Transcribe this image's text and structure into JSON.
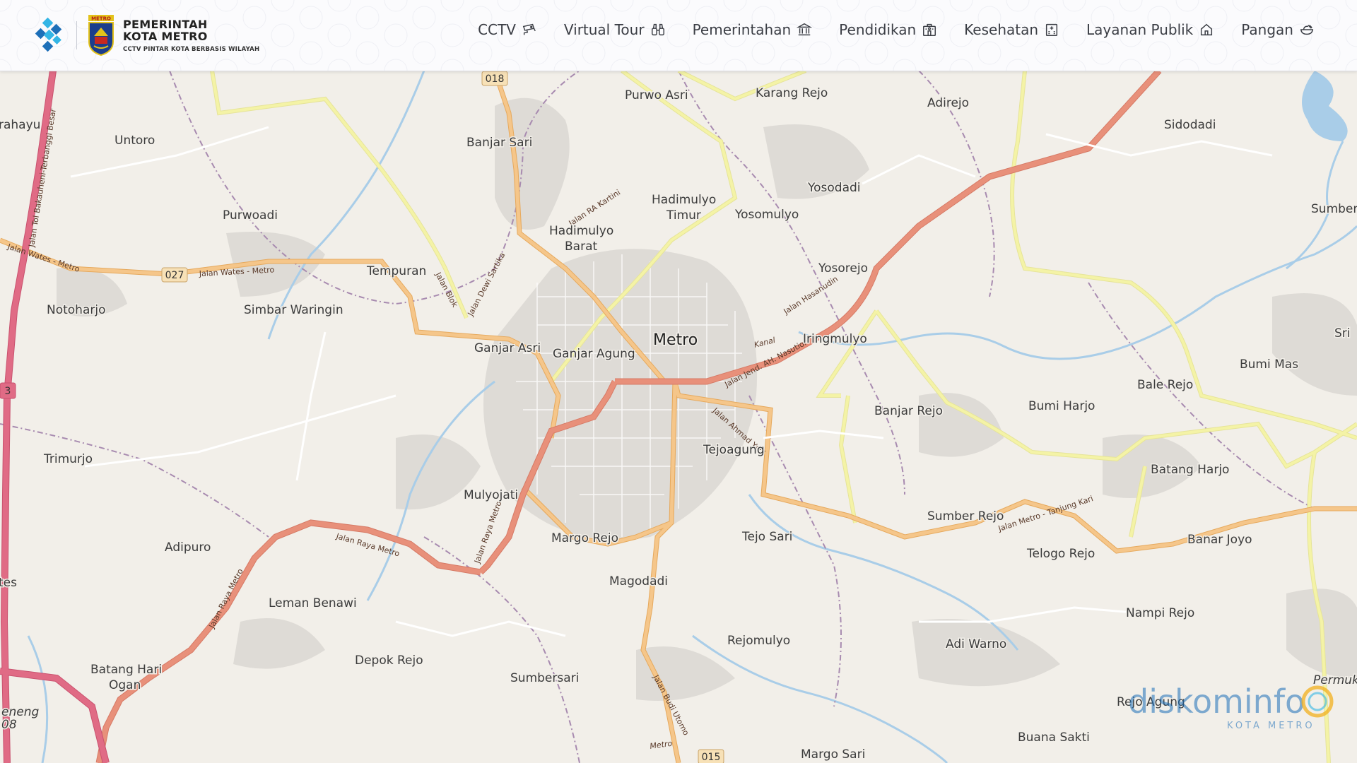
{
  "header": {
    "brand_line1": "PEMERINTAH",
    "brand_line2": "KOTA METRO",
    "brand_tagline": "CCTV PINTAR KOTA BERBASIS WILAYAH",
    "seal_text": "METRO"
  },
  "nav": [
    {
      "label": "CCTV",
      "icon": "cctv-icon"
    },
    {
      "label": "Virtual Tour",
      "icon": "binoculars-icon"
    },
    {
      "label": "Pemerintahan",
      "icon": "government-building-icon"
    },
    {
      "label": "Pendidikan",
      "icon": "school-icon"
    },
    {
      "label": "Kesehatan",
      "icon": "hospital-icon"
    },
    {
      "label": "Layanan Publik",
      "icon": "home-icon"
    },
    {
      "label": "Pangan",
      "icon": "food-bowl-icon"
    }
  ],
  "map": {
    "places": {
      "rahayu": "rahayu",
      "untoro": "Untoro",
      "banjar_sari": "Banjar Sari",
      "purwo_asri": "Purwo Asri",
      "karang_rejo": "Karang Rejo",
      "adirejo": "Adirejo",
      "sidodadi": "Sidodadi",
      "sumber_ag": "Sumber Ag",
      "purwoadi": "Purwoadi",
      "hadimulyo_timur_1": "Hadimulyo",
      "hadimulyo_timur_2": "Timur",
      "yosomulyo": "Yosomulyo",
      "yosodadi": "Yosodadi",
      "hadimulyo_barat_1": "Hadimulyo",
      "hadimulyo_barat_2": "Barat",
      "notoharjo": "Notoharjo",
      "tempuran": "Tempuran",
      "simbar_waringin": "Simbar Waringin",
      "yosorejo": "Yosorejo",
      "metro": "Metro",
      "ganjar_asri": "Ganjar Asri",
      "ganjar_agung": "Ganjar Agung",
      "iringmulyo": "Iringmulyo",
      "sri": "Sri",
      "bumi_mas": "Bumi Mas",
      "bale_rejo": "Bale Rejo",
      "banjar_rejo": "Banjar Rejo",
      "bumi_harjo": "Bumi Harjo",
      "tejoagung": "Tejoagung",
      "trimurjo": "Trimurjo",
      "batang_harjo": "Batang Harjo",
      "mulyojati": "Mulyojati",
      "sumber_rejo": "Sumber Rejo",
      "adipuro": "Adipuro",
      "margo_rejo": "Margo Rejo",
      "tejo_sari": "Tejo Sari",
      "telogo_rejo": "Telogo Rejo",
      "banar_joyo": "Banar Joyo",
      "tes": "tes",
      "magodadi": "Magodadi",
      "leman_benawi": "Leman Benawi",
      "nampi_rejo": "Nampi Rejo",
      "rejomulyo": "Rejomulyo",
      "adi_warno": "Adi Warno",
      "depok_rejo": "Depok Rejo",
      "batang_hari_1": "Batang Hari",
      "batang_hari_2": "Ogan",
      "sumbersari": "Sumbersari",
      "permuk": "Permuk",
      "rejo_agung": "Rejo Agung",
      "buana_sakti": "Buana Sakti",
      "margo_sari": "Margo Sari",
      "eneng_1": "eneng",
      "eneng_2": "08"
    },
    "roads": {
      "jalan_tol": "Jalan Tol Bakauheni-Terbanggi Besar",
      "jalan_wates_metro_1": "Jalan Wates - Metro",
      "jalan_wates_metro_2": "Jalan Wates - Metro",
      "jalan_ra_kartini": "Jalan RA Kartini",
      "jalan_blok": "Jalan Blok",
      "jalan_dewi_sartika": "Jalan Dewi Sartika",
      "jalan_hasanudin": "Jalan Hasanudin",
      "jalan_ah_nasution": "Jalan Jend. AH. Nasution",
      "jalan_ahmad_yani": "Jalan Ahmad Yani",
      "jalan_raya_metro_1": "Jalan Raya Metro",
      "jalan_raya_metro_2": "Jalan Raya Metro",
      "jalan_raya_metro_3": "Jalan Raya Metro",
      "jalan_metro_tanjung_kari": "Jalan Metro - Tanjung Kari",
      "jalan_budi_utomo": "Jalan Budi Utomo",
      "kanal": "Kanal",
      "metro_river": "Metro"
    },
    "shields": {
      "r018": "018",
      "r027": "027",
      "r015": "015",
      "r3": "3"
    }
  },
  "watermark": {
    "name": "diskominfo",
    "sub": "KOTA METRO"
  },
  "colors": {
    "land": "#f2efe9",
    "primary_road": "#e8907a",
    "secondary_road": "#f5c68a",
    "tertiary_road": "#f4f3a6",
    "motorway": "#e06b85",
    "water": "#a9cde8",
    "boundary": "#a88bb0",
    "brand_blue": "#1d6fb8",
    "watermark_gold": "#f2b01e"
  }
}
